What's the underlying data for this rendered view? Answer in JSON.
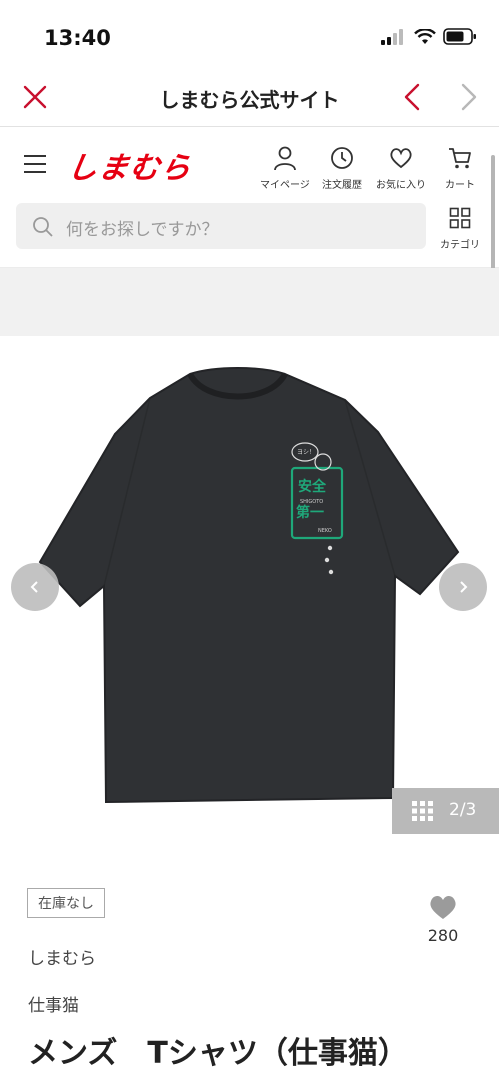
{
  "status_bar": {
    "time": "13:40"
  },
  "browser": {
    "title": "しまむら公式サイト"
  },
  "header": {
    "logo": "しまむら",
    "nav": [
      {
        "label": "マイページ",
        "icon": "person-icon"
      },
      {
        "label": "注文履歴",
        "icon": "clock-icon"
      },
      {
        "label": "お気に入り",
        "icon": "heart-icon"
      },
      {
        "label": "カート",
        "icon": "cart-icon"
      }
    ],
    "search_placeholder": "何をお探しですか？",
    "category_label": "カテゴリ"
  },
  "gallery": {
    "counter": "2/3",
    "print_text": {
      "line1": "安全",
      "line2": "第一",
      "small1": "SHIGOTO",
      "small2": "NEKO",
      "bubble": "ヨシ！"
    }
  },
  "product": {
    "stock_badge": "在庫なし",
    "like_count": "280",
    "brand": "しまむら",
    "series": "仕事猫",
    "name": "メンズ　Tシャツ（仕事猫）"
  },
  "colors": {
    "brand_red": "#e60012",
    "shirt": "#2f3134",
    "print_green": "#1fa87a"
  }
}
